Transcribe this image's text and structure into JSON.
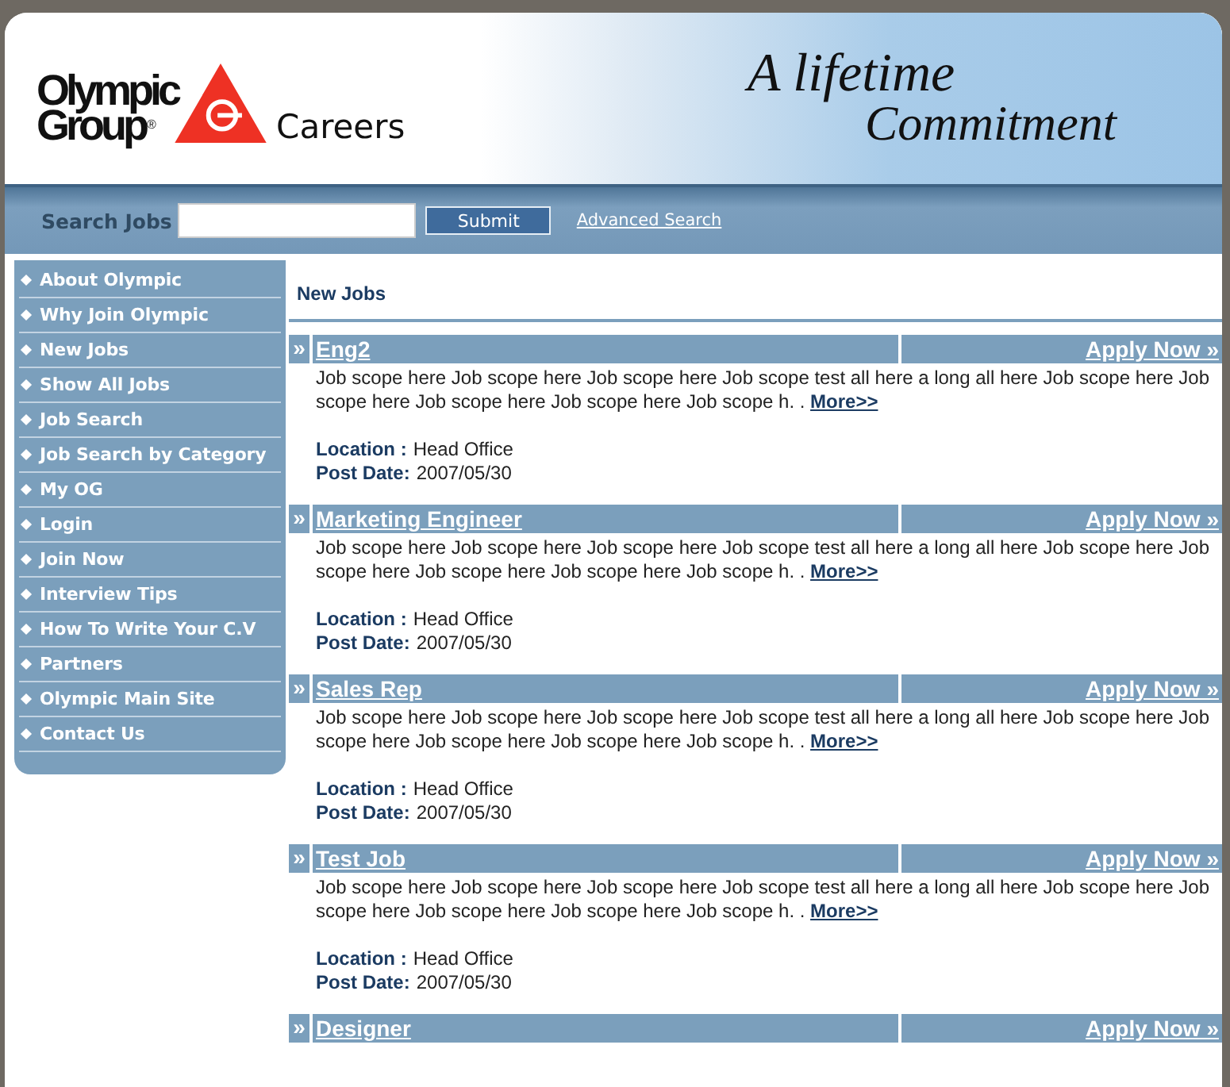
{
  "header": {
    "logo_line_1": "Olympic",
    "logo_line_2": "Group",
    "logo_registered": "®",
    "site_title": "Careers",
    "tagline_line_1": "A lifetime",
    "tagline_line_2": "Commitment"
  },
  "search": {
    "label": "Search Jobs",
    "button": "Submit",
    "advanced_link": "Advanced Search"
  },
  "sidebar": {
    "items": [
      "About Olympic",
      "Why Join Olympic",
      "New Jobs",
      "Show All Jobs",
      "Job Search",
      "Job Search by Category",
      "My OG",
      "Login",
      "Join Now",
      "Interview Tips",
      "How To Write Your C.V",
      "Partners",
      "Olympic Main Site",
      "Contact Us"
    ]
  },
  "main": {
    "heading": "New Jobs",
    "jobs": [
      {
        "marker": "»",
        "title": "Eng2",
        "apply": "Apply Now »",
        "description": "Job scope here Job scope here Job scope here Job scope test all here a long all here Job scope here Job scope here Job scope here Job scope here Job scope h. .",
        "more": "More>>",
        "location_label": "Location :",
        "location": "Head Office",
        "date_label": "Post Date:",
        "date": "2007/05/30"
      },
      {
        "marker": "»",
        "title": "Marketing Engineer",
        "apply": "Apply Now »",
        "description": "Job scope here Job scope here Job scope here Job scope test all here a long all here Job scope here Job scope here Job scope here Job scope here Job scope h. .",
        "more": "More>>",
        "location_label": "Location :",
        "location": "Head Office",
        "date_label": "Post Date:",
        "date": "2007/05/30"
      },
      {
        "marker": "»",
        "title": "Sales Rep",
        "apply": "Apply Now »",
        "description": "Job scope here Job scope here Job scope here Job scope test all here a long all here Job scope here Job scope here Job scope here Job scope here Job scope h. .",
        "more": "More>>",
        "location_label": "Location :",
        "location": "Head Office",
        "date_label": "Post Date:",
        "date": "2007/05/30"
      },
      {
        "marker": "»",
        "title": "Test Job",
        "apply": "Apply Now »",
        "description": "Job scope here Job scope here Job scope here Job scope test all here a long all here Job scope here Job scope here Job scope here Job scope here Job scope h. .",
        "more": "More>>",
        "location_label": "Location :",
        "location": "Head Office",
        "date_label": "Post Date:",
        "date": "2007/05/30"
      },
      {
        "marker": "»",
        "title": "Designer",
        "apply": "Apply Now »"
      }
    ]
  }
}
